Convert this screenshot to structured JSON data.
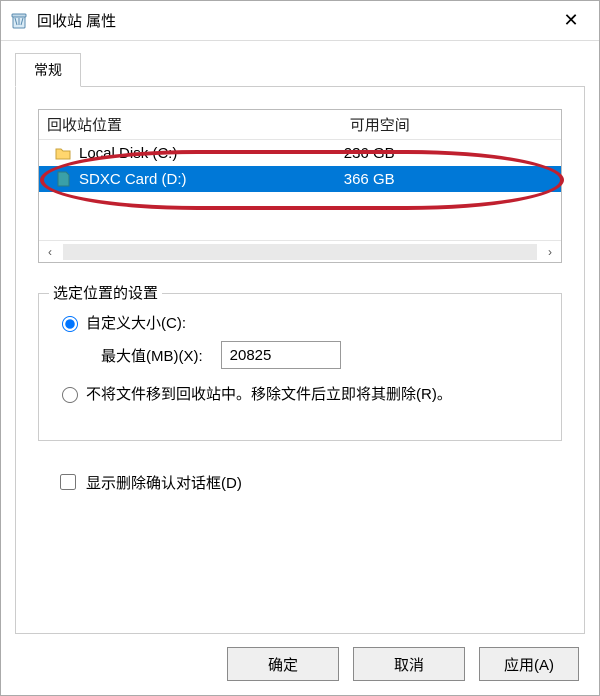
{
  "title": "回收站 属性",
  "tab": {
    "label": "常规"
  },
  "list": {
    "headers": {
      "location": "回收站位置",
      "available": "可用空间"
    },
    "rows": [
      {
        "name": "Local Disk (C:)",
        "size": "236 GB",
        "selected": false,
        "icon": "drive-icon"
      },
      {
        "name": "SDXC Card (D:)",
        "size": "366 GB",
        "selected": true,
        "icon": "sd-icon"
      }
    ]
  },
  "group": {
    "title": "选定位置的设置",
    "custom_size_label": "自定义大小(C):",
    "max_value_label": "最大值(MB)(X):",
    "max_value": "20825",
    "no_bin_label": "不将文件移到回收站中。移除文件后立即将其删除(R)。",
    "selected_option": "custom"
  },
  "confirm_delete_label": "显示删除确认对话框(D)",
  "confirm_delete_checked": false,
  "buttons": {
    "ok": "确定",
    "cancel": "取消",
    "apply": "应用(A)"
  },
  "annotation": {
    "color": "#c0202f"
  }
}
